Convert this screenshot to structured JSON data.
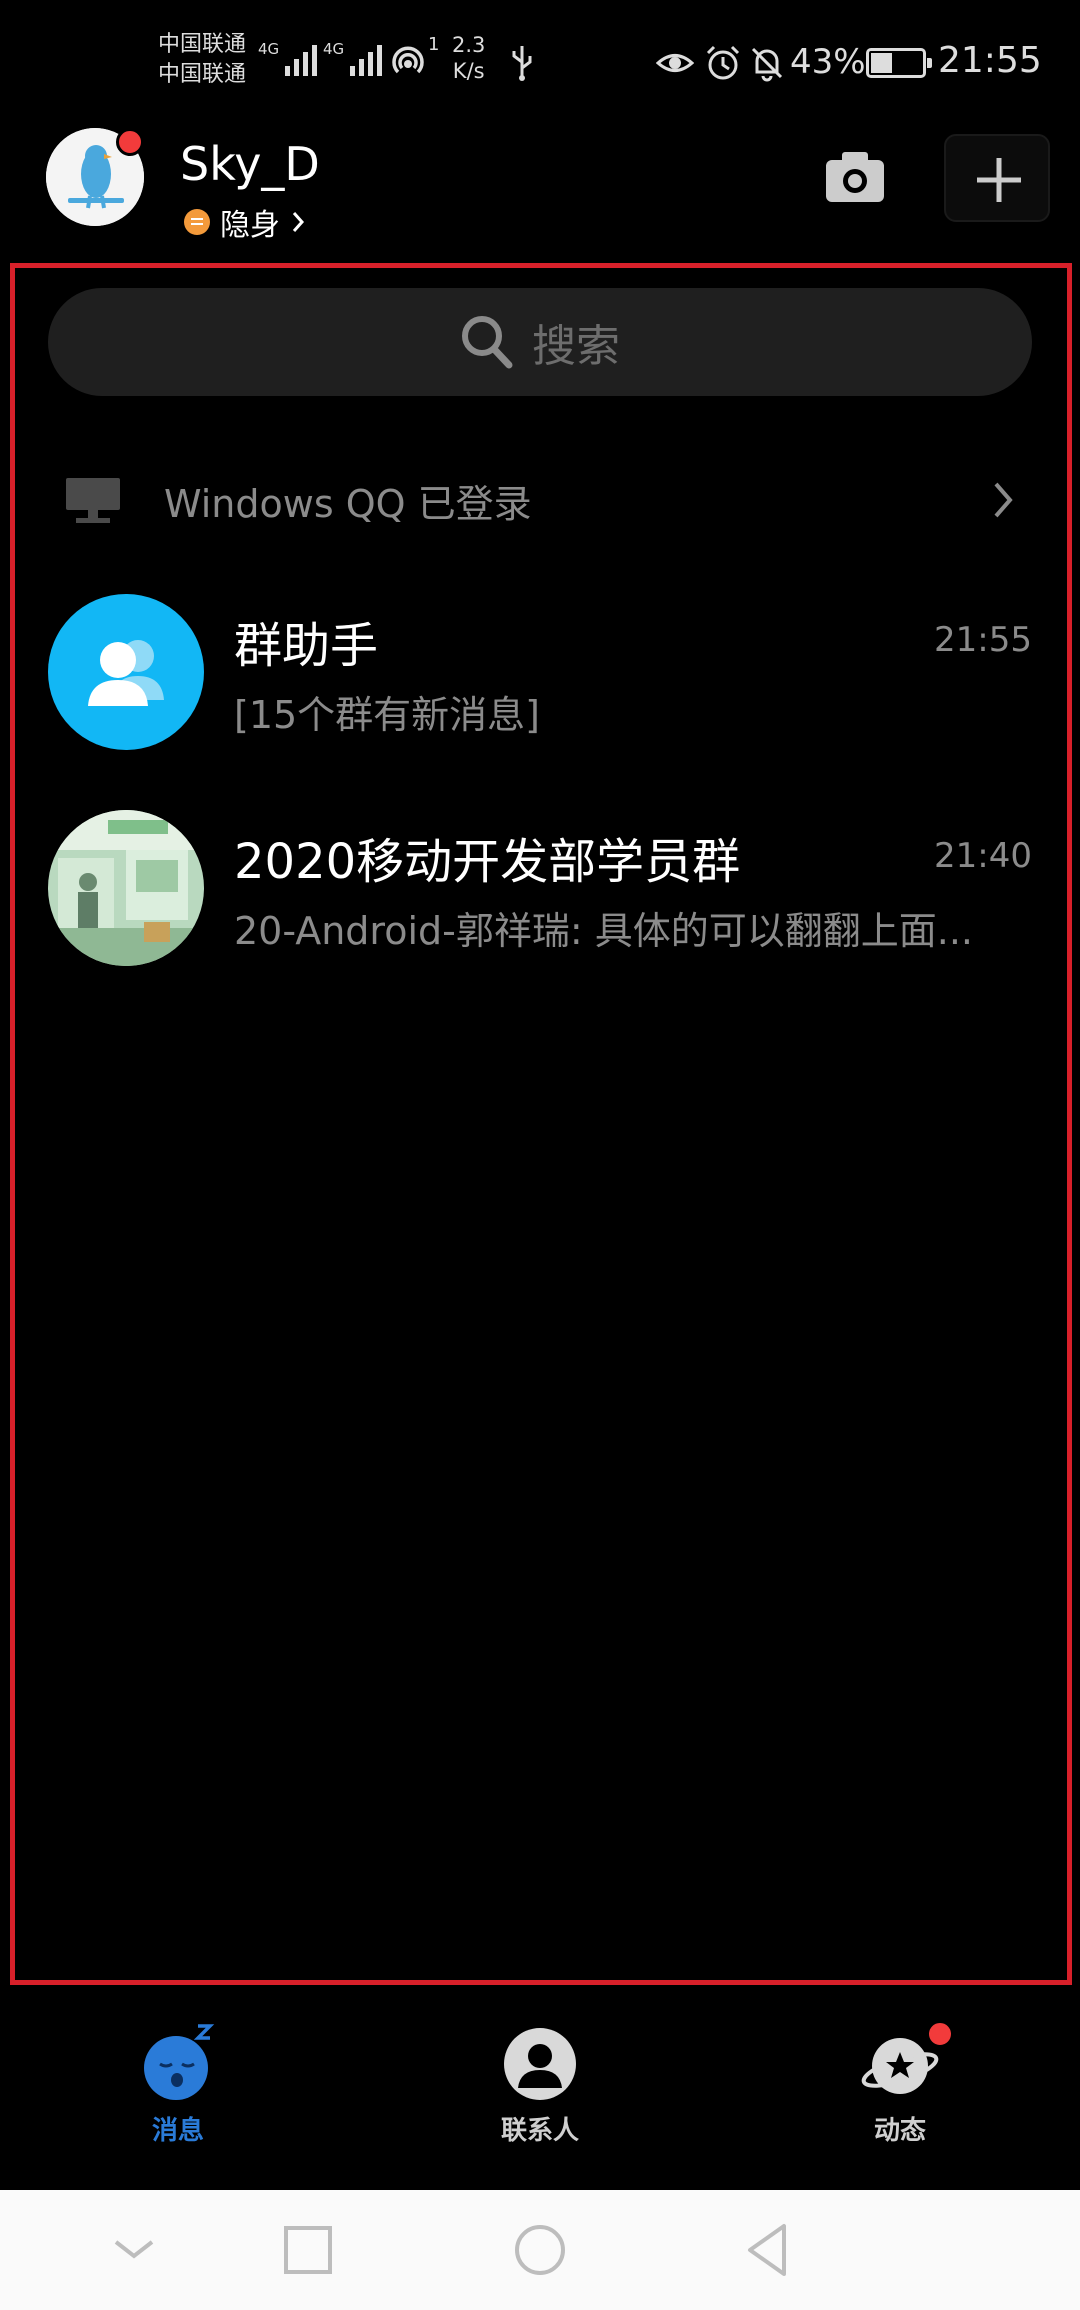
{
  "status_bar": {
    "carrier1": "中国联通",
    "carrier2": "中国联通",
    "net1": "4G",
    "net2": "4G",
    "hotspot_count": "1",
    "speed_value": "2.3",
    "speed_unit": "K/s",
    "battery_percent": "43%",
    "battery_level": 0.43,
    "time": "21:55",
    "icons": [
      "signal-icon",
      "signal-icon",
      "hotspot-icon",
      "usb-icon",
      "eye-icon",
      "alarm-icon",
      "mute-icon",
      "battery-icon"
    ]
  },
  "header": {
    "username": "Sky_D",
    "status": "隐身",
    "avatar_icon": "bird-avatar",
    "camera_icon": "camera-icon",
    "add_icon": "plus-icon"
  },
  "search": {
    "label": "搜索",
    "icon": "search-icon"
  },
  "login_notice": {
    "text": "Windows QQ 已登录",
    "icon": "computer-icon"
  },
  "chats": [
    {
      "name": "群助手",
      "time": "21:55",
      "message": "[15个群有新消息]",
      "avatar": "group-assistant-icon"
    },
    {
      "name": "2020移动开发部学员群",
      "time": "21:40",
      "message": "20-Android-郭祥瑞: 具体的可以翻翻上面...",
      "avatar": "group-photo"
    }
  ],
  "tabs": [
    {
      "label": "消息",
      "icon": "sleeping-face-icon",
      "active": true
    },
    {
      "label": "联系人",
      "icon": "contact-icon",
      "active": false
    },
    {
      "label": "动态",
      "icon": "planet-icon",
      "active": false,
      "badge": true
    }
  ],
  "colors": {
    "accent": "#2a7bd8",
    "badge": "#f23b3b",
    "highlight_frame": "#d7202a",
    "group_assistant_bg": "#12b7f5"
  }
}
